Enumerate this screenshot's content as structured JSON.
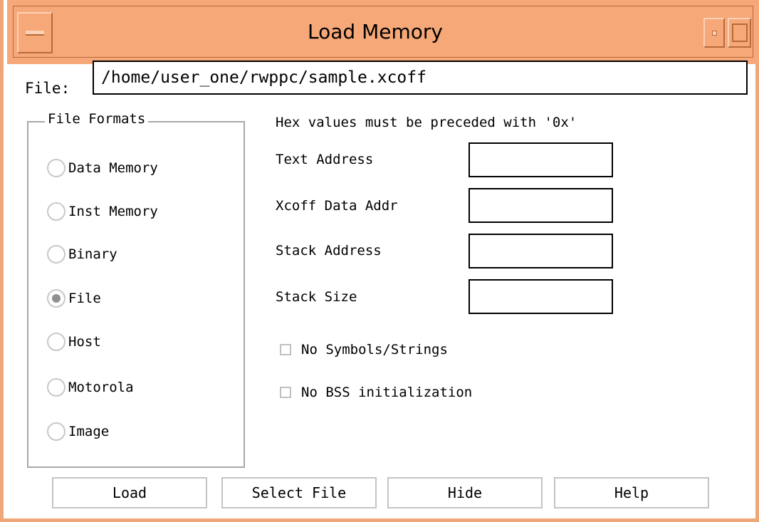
{
  "window": {
    "title": "Load Memory"
  },
  "file": {
    "label": "File:",
    "value": "/home/user_one/rwppc/sample.xcoff"
  },
  "formats": {
    "legend": "File Formats",
    "options": [
      {
        "label": "Data Memory",
        "checked": false
      },
      {
        "label": "Inst Memory",
        "checked": false
      },
      {
        "label": "Binary",
        "checked": false
      },
      {
        "label": "File",
        "checked": true
      },
      {
        "label": "Host",
        "checked": false
      },
      {
        "label": "Motorola",
        "checked": false
      },
      {
        "label": "Image",
        "checked": false
      }
    ]
  },
  "addresses": {
    "note": "Hex values must be preceded with '0x'",
    "fields": [
      {
        "label": "Text Address",
        "value": ""
      },
      {
        "label": "Xcoff Data Addr",
        "value": ""
      },
      {
        "label": "Stack Address",
        "value": ""
      },
      {
        "label": "Stack Size",
        "value": ""
      }
    ]
  },
  "options": [
    {
      "label": "No Symbols/Strings",
      "checked": false
    },
    {
      "label": "No BSS initialization",
      "checked": false
    }
  ],
  "buttons": {
    "load": "Load",
    "select_file": "Select File",
    "hide": "Hide",
    "help": "Help"
  },
  "colors": {
    "titlebar": "#f6a878",
    "frame": "#f0a778"
  }
}
